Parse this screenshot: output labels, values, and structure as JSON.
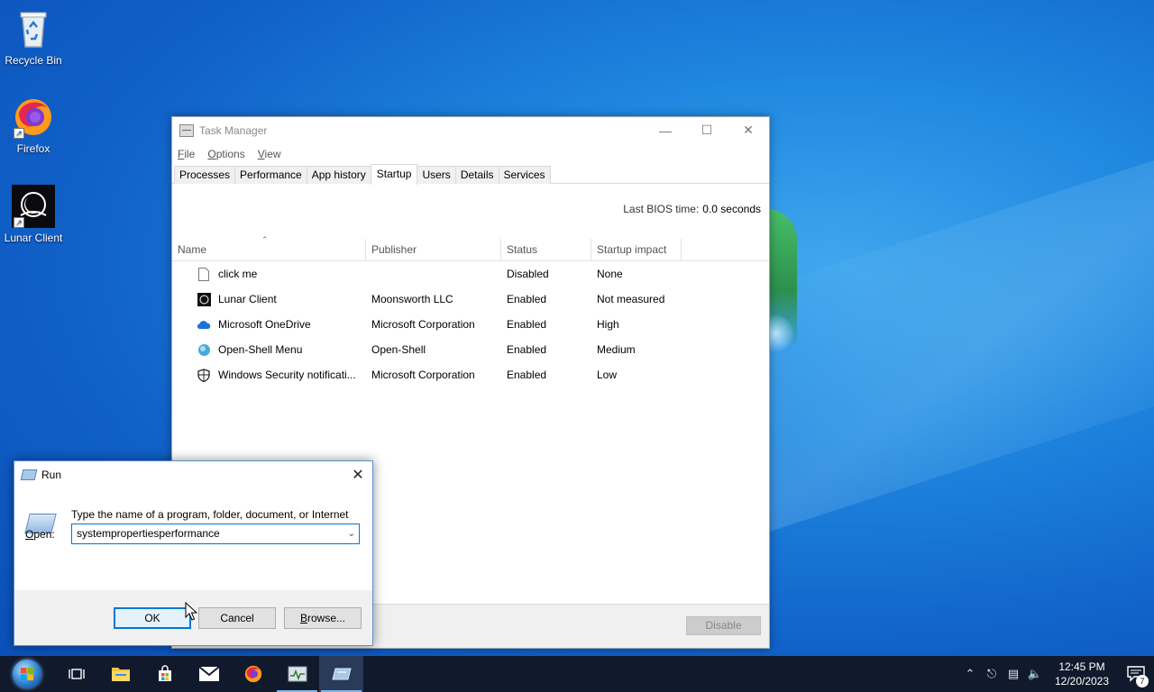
{
  "desktop": {
    "icons": [
      {
        "label": "Recycle Bin",
        "icon": "recycle-bin-icon"
      },
      {
        "label": "Firefox",
        "icon": "firefox-icon"
      },
      {
        "label": "Lunar Client",
        "icon": "lunar-client-icon"
      }
    ]
  },
  "task_manager": {
    "title": "Task Manager",
    "menu": [
      "File",
      "Options",
      "View"
    ],
    "tabs": [
      "Processes",
      "Performance",
      "App history",
      "Startup",
      "Users",
      "Details",
      "Services"
    ],
    "active_tab": "Startup",
    "bios_label": "Last BIOS time:",
    "bios_value": "0.0 seconds",
    "columns": [
      "Name",
      "Publisher",
      "Status",
      "Startup impact"
    ],
    "rows": [
      {
        "name": "click me",
        "publisher": "",
        "status": "Disabled",
        "impact": "None",
        "icon": "file-icon"
      },
      {
        "name": "Lunar Client",
        "publisher": "Moonsworth LLC",
        "status": "Enabled",
        "impact": "Not measured",
        "icon": "lunar-client-icon"
      },
      {
        "name": "Microsoft OneDrive",
        "publisher": "Microsoft Corporation",
        "status": "Enabled",
        "impact": "High",
        "icon": "onedrive-icon"
      },
      {
        "name": "Open-Shell Menu",
        "publisher": "Open-Shell",
        "status": "Enabled",
        "impact": "Medium",
        "icon": "open-shell-icon"
      },
      {
        "name": "Windows Security notificati...",
        "publisher": "Microsoft Corporation",
        "status": "Enabled",
        "impact": "Low",
        "icon": "shield-icon"
      }
    ],
    "disable_button": "Disable"
  },
  "run_dialog": {
    "title": "Run",
    "description": "Type the name of a program, folder, document, or Internet resource, and Windows will open it for you.",
    "open_label_prefix": "",
    "open_label_u": "O",
    "open_label_rest": "pen:",
    "input_value": "systempropertiesperformance",
    "ok": "OK",
    "cancel": "Cancel",
    "browse_u": "B",
    "browse_rest": "rowse..."
  },
  "taskbar": {
    "time": "12:45 PM",
    "date": "12/20/2023",
    "notification_count": "7"
  }
}
